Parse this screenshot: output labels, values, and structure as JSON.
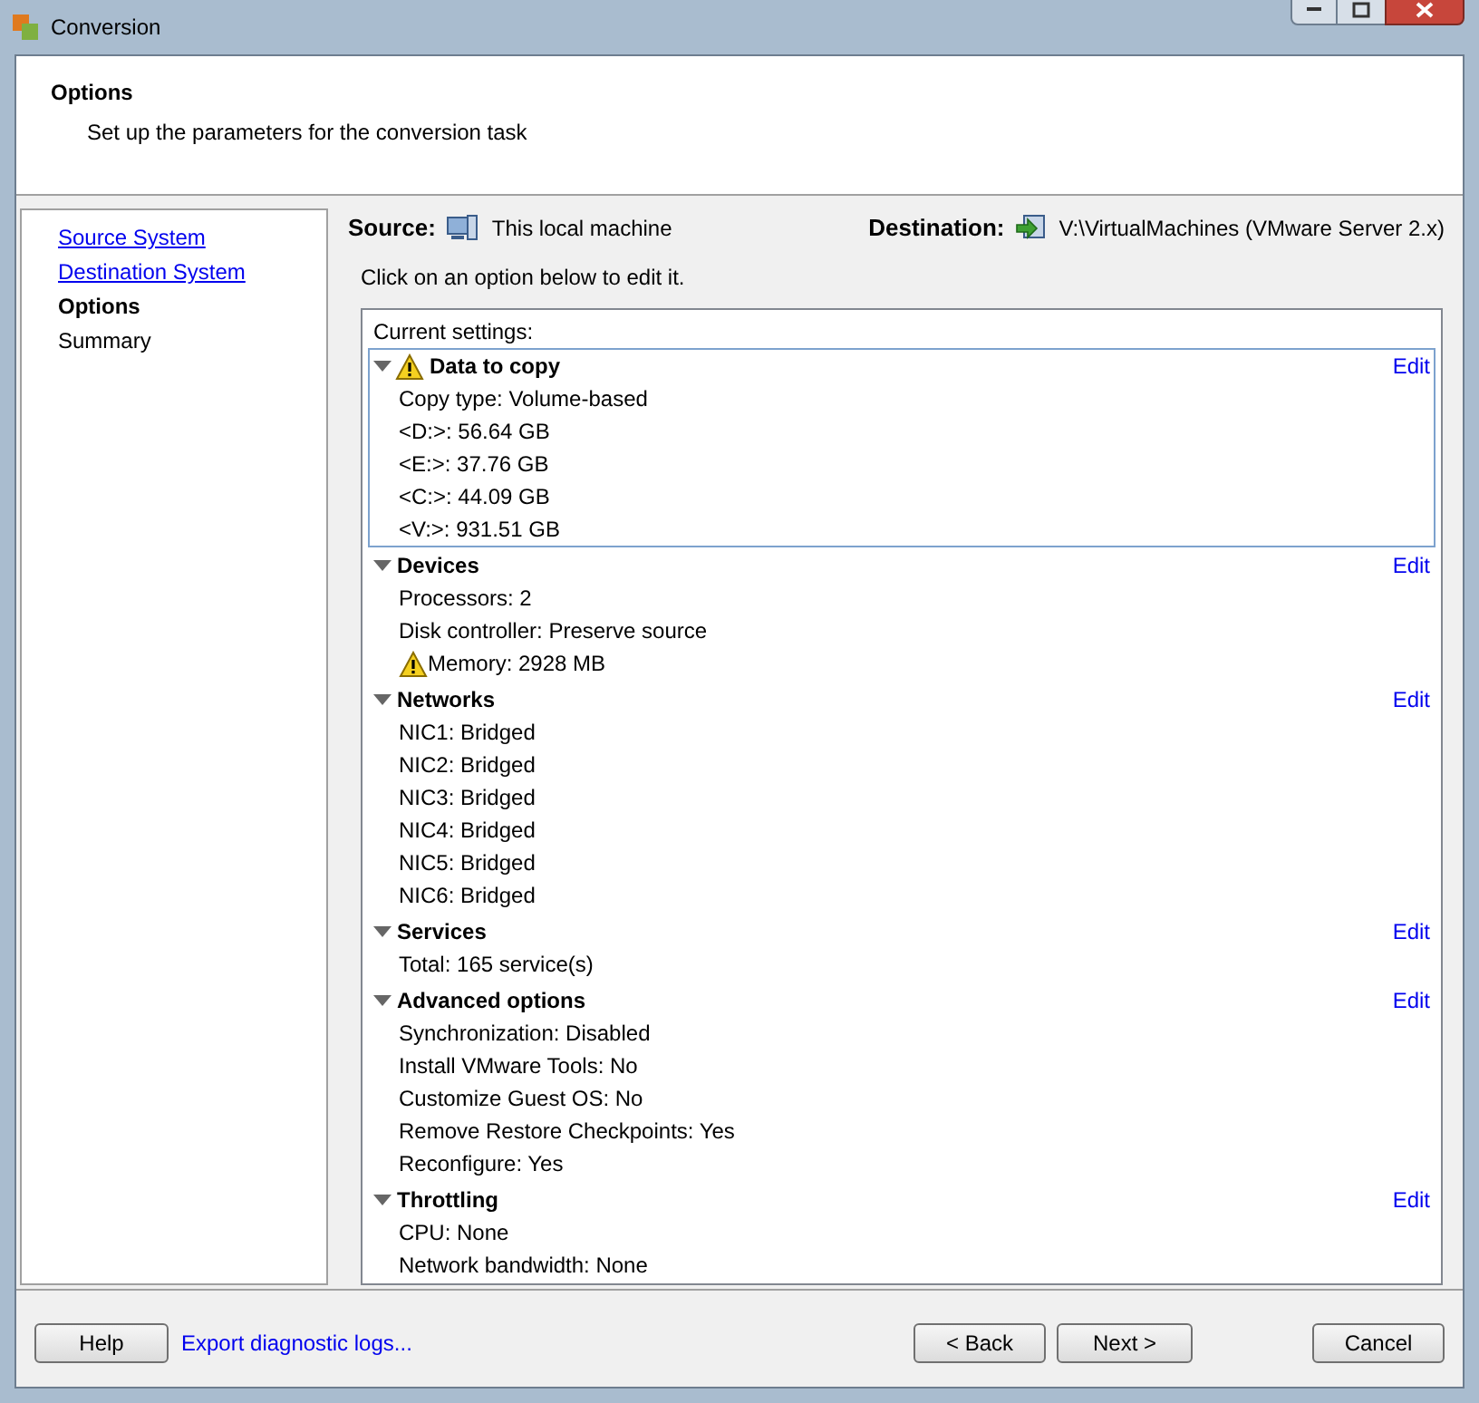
{
  "window": {
    "title": "Conversion"
  },
  "header": {
    "title": "Options",
    "subtitle": "Set up the parameters for the conversion task"
  },
  "sidebar": {
    "items": [
      {
        "label": "Source System",
        "kind": "link",
        "selected": false
      },
      {
        "label": "Destination System",
        "kind": "link",
        "selected": false
      },
      {
        "label": "Options",
        "kind": "text",
        "selected": true
      },
      {
        "label": "Summary",
        "kind": "text",
        "selected": false
      }
    ]
  },
  "source": {
    "label": "Source:",
    "value": "This local machine"
  },
  "destination": {
    "label": "Destination:",
    "value": "V:\\VirtualMachines (VMware Server 2.x)"
  },
  "instruction": "Click on an option below to edit it.",
  "settings": {
    "title": "Current settings:",
    "sections": [
      {
        "title": "Data to copy",
        "warning": true,
        "selected": true,
        "expanded": true,
        "edit": "Edit",
        "items": [
          {
            "text": "Copy type: Volume-based",
            "warning": false
          },
          {
            "text": "<D:>: 56.64 GB",
            "warning": false
          },
          {
            "text": "<E:>: 37.76 GB",
            "warning": false
          },
          {
            "text": "<C:>: 44.09 GB",
            "warning": false
          },
          {
            "text": "<V:>: 931.51 GB",
            "warning": false
          }
        ]
      },
      {
        "title": "Devices",
        "warning": false,
        "selected": false,
        "expanded": true,
        "edit": "Edit",
        "items": [
          {
            "text": "Processors: 2",
            "warning": false
          },
          {
            "text": "Disk controller: Preserve source",
            "warning": false
          },
          {
            "text": "Memory: 2928 MB",
            "warning": true
          }
        ]
      },
      {
        "title": "Networks",
        "warning": false,
        "selected": false,
        "expanded": true,
        "edit": "Edit",
        "items": [
          {
            "text": "NIC1: Bridged",
            "warning": false
          },
          {
            "text": "NIC2: Bridged",
            "warning": false
          },
          {
            "text": "NIC3: Bridged",
            "warning": false
          },
          {
            "text": "NIC4: Bridged",
            "warning": false
          },
          {
            "text": "NIC5: Bridged",
            "warning": false
          },
          {
            "text": "NIC6: Bridged",
            "warning": false
          }
        ]
      },
      {
        "title": "Services",
        "warning": false,
        "selected": false,
        "expanded": true,
        "edit": "Edit",
        "items": [
          {
            "text": "Total: 165 service(s)",
            "warning": false
          }
        ]
      },
      {
        "title": "Advanced options",
        "warning": false,
        "selected": false,
        "expanded": true,
        "edit": "Edit",
        "items": [
          {
            "text": "Synchronization: Disabled",
            "warning": false
          },
          {
            "text": "Install VMware Tools: No",
            "warning": false
          },
          {
            "text": "Customize Guest OS: No",
            "warning": false
          },
          {
            "text": "Remove Restore Checkpoints: Yes",
            "warning": false
          },
          {
            "text": "Reconfigure: Yes",
            "warning": false
          }
        ]
      },
      {
        "title": "Throttling",
        "warning": false,
        "selected": false,
        "expanded": true,
        "edit": "Edit",
        "items": [
          {
            "text": "CPU: None",
            "warning": false
          },
          {
            "text": "Network bandwidth: None",
            "warning": false
          }
        ]
      }
    ]
  },
  "footer": {
    "help": "Help",
    "export_link": "Export diagnostic logs...",
    "back": "< Back",
    "next": "Next >",
    "cancel": "Cancel"
  }
}
